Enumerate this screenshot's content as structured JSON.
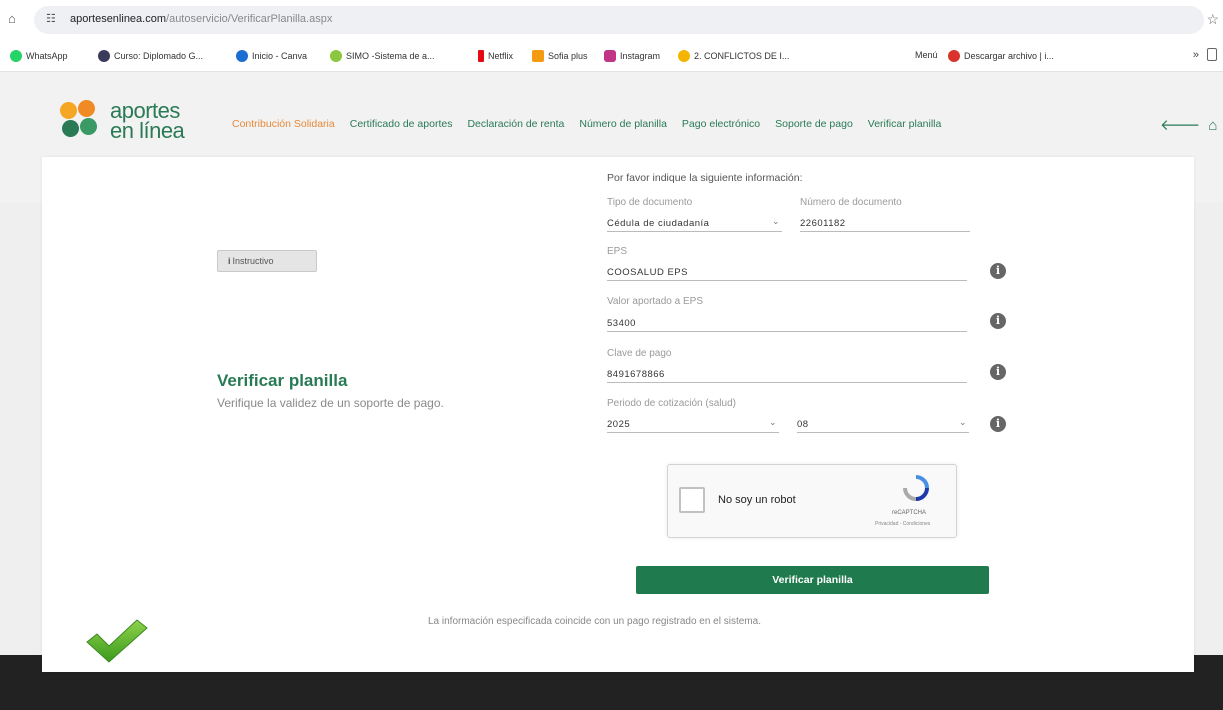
{
  "browser": {
    "url_domain": "aportesenlinea.com",
    "url_path": "/autoservicio/VerificarPlanilla.aspx",
    "bookmarks": [
      {
        "label": "WhatsApp",
        "color": "#25d366"
      },
      {
        "label": "Curso: Diplomado G...",
        "color": "#3a3a5a"
      },
      {
        "label": "Inicio - Canva",
        "color": "#1b6dd1"
      },
      {
        "label": "SIMO -Sistema de a...",
        "color": "#8cc63f"
      },
      {
        "label": "Netflix",
        "color": "#e50914"
      },
      {
        "label": "Sofia plus",
        "color": "#f39c12"
      },
      {
        "label": "Instagram",
        "color": "#c13584"
      },
      {
        "label": "2. CONFLICTOS DE I...",
        "color": "#f4b400"
      },
      {
        "label": "Menú",
        "color": "#ffffff"
      },
      {
        "label": "Descargar archivo | i...",
        "color": "#d9342b"
      }
    ],
    "more_label": "»"
  },
  "site": {
    "logo_line1": "aportes",
    "logo_line2": "en línea",
    "nav": [
      {
        "label": "Contribución Solidaria",
        "active": true
      },
      {
        "label": "Certificado de aportes",
        "active": false
      },
      {
        "label": "Declaración de renta",
        "active": false
      },
      {
        "label": "Número de planilla",
        "active": false
      },
      {
        "label": "Pago electrónico",
        "active": false
      },
      {
        "label": "Soporte de pago",
        "active": false
      },
      {
        "label": "Verificar planilla",
        "active": false
      }
    ],
    "back_icon": "arrow-left-icon",
    "home_icon": "home-icon",
    "colors": {
      "brand": "#2a7a56",
      "accent": "#e58a3a",
      "button": "#1f7a4d"
    }
  },
  "left": {
    "instructivo_icon": "i",
    "instructivo_label": "Instructivo",
    "title": "Verificar planilla",
    "subtitle": "Verifique la validez de un soporte de pago."
  },
  "form": {
    "heading": "Por favor indique la siguiente información:",
    "tipo_documento": {
      "label": "Tipo de documento",
      "value": "Cédula de ciudadanía"
    },
    "numero_documento": {
      "label": "Número de documento",
      "value": "22601182"
    },
    "eps": {
      "label": "EPS",
      "value": "COOSALUD EPS"
    },
    "valor_eps": {
      "label": "Valor aportado a EPS",
      "value": "53400"
    },
    "clave_pago": {
      "label": "Clave de pago",
      "value": "8491678866"
    },
    "periodo": {
      "label": "Periodo de cotización (salud)",
      "year": "2025",
      "month": "08"
    },
    "captcha": {
      "label": "No soy un robot",
      "brand": "reCAPTCHA",
      "terms": "Privacidad - Condiciones"
    },
    "submit_label": "Verificar planilla",
    "result": "La información especificada coincide con un pago registrado en el sistema."
  }
}
